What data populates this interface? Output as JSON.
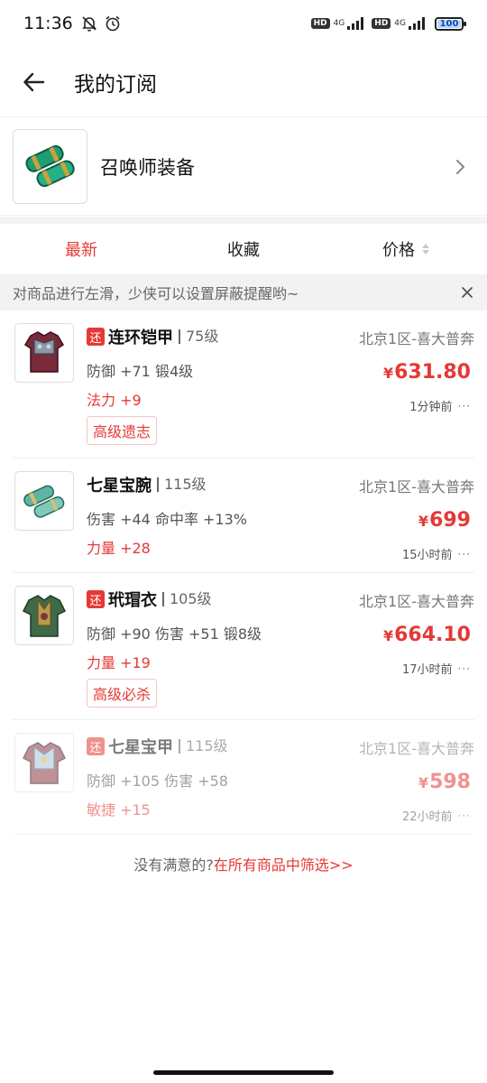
{
  "status_bar": {
    "time": "11:36",
    "net1": "4G",
    "net2": "4G",
    "hd1": "HD",
    "hd2": "HD",
    "battery": "100"
  },
  "header": {
    "title": "我的订阅"
  },
  "subscription": {
    "name": "召唤师装备"
  },
  "tabs": {
    "latest": "最新",
    "favorites": "收藏",
    "price": "价格"
  },
  "tip": {
    "text": "对商品进行左滑，少侠可以设置屏蔽提醒哟~"
  },
  "items": [
    {
      "return_badge": "还",
      "name": "连环铠甲",
      "level": "75级",
      "server": "北京1区-喜大普奔",
      "stats": "防御 +71 锻4级",
      "extra": "法力 +9",
      "price_symbol": "¥",
      "price": "631.80",
      "time": "1分钟前",
      "tag": "高级遗志",
      "more": "···"
    },
    {
      "return_badge": "",
      "name": "七星宝腕",
      "level": "115级",
      "server": "北京1区-喜大普奔",
      "stats": "伤害 +44 命中率 +13%",
      "extra": "力量 +28",
      "price_symbol": "¥",
      "price": "699",
      "time": "15小时前",
      "tag": "",
      "more": "···"
    },
    {
      "return_badge": "还",
      "name": "玳瑁衣",
      "level": "105级",
      "server": "北京1区-喜大普奔",
      "stats": "防御 +90 伤害 +51 锻8级",
      "extra": "力量 +19",
      "price_symbol": "¥",
      "price": "664.10",
      "time": "17小时前",
      "tag": "高级必杀",
      "more": "···"
    },
    {
      "return_badge": "还",
      "name": "七星宝甲",
      "level": "115级",
      "server": "北京1区-喜大普奔",
      "stats": "防御 +105 伤害 +58",
      "extra": "敏捷 +15",
      "price_symbol": "¥",
      "price": "598",
      "time": "22小时前",
      "tag": "",
      "more": "···"
    }
  ],
  "footer": {
    "prefix": "没有满意的?",
    "link": "在所有商品中筛选>>"
  },
  "colors": {
    "accent": "#e53935"
  }
}
